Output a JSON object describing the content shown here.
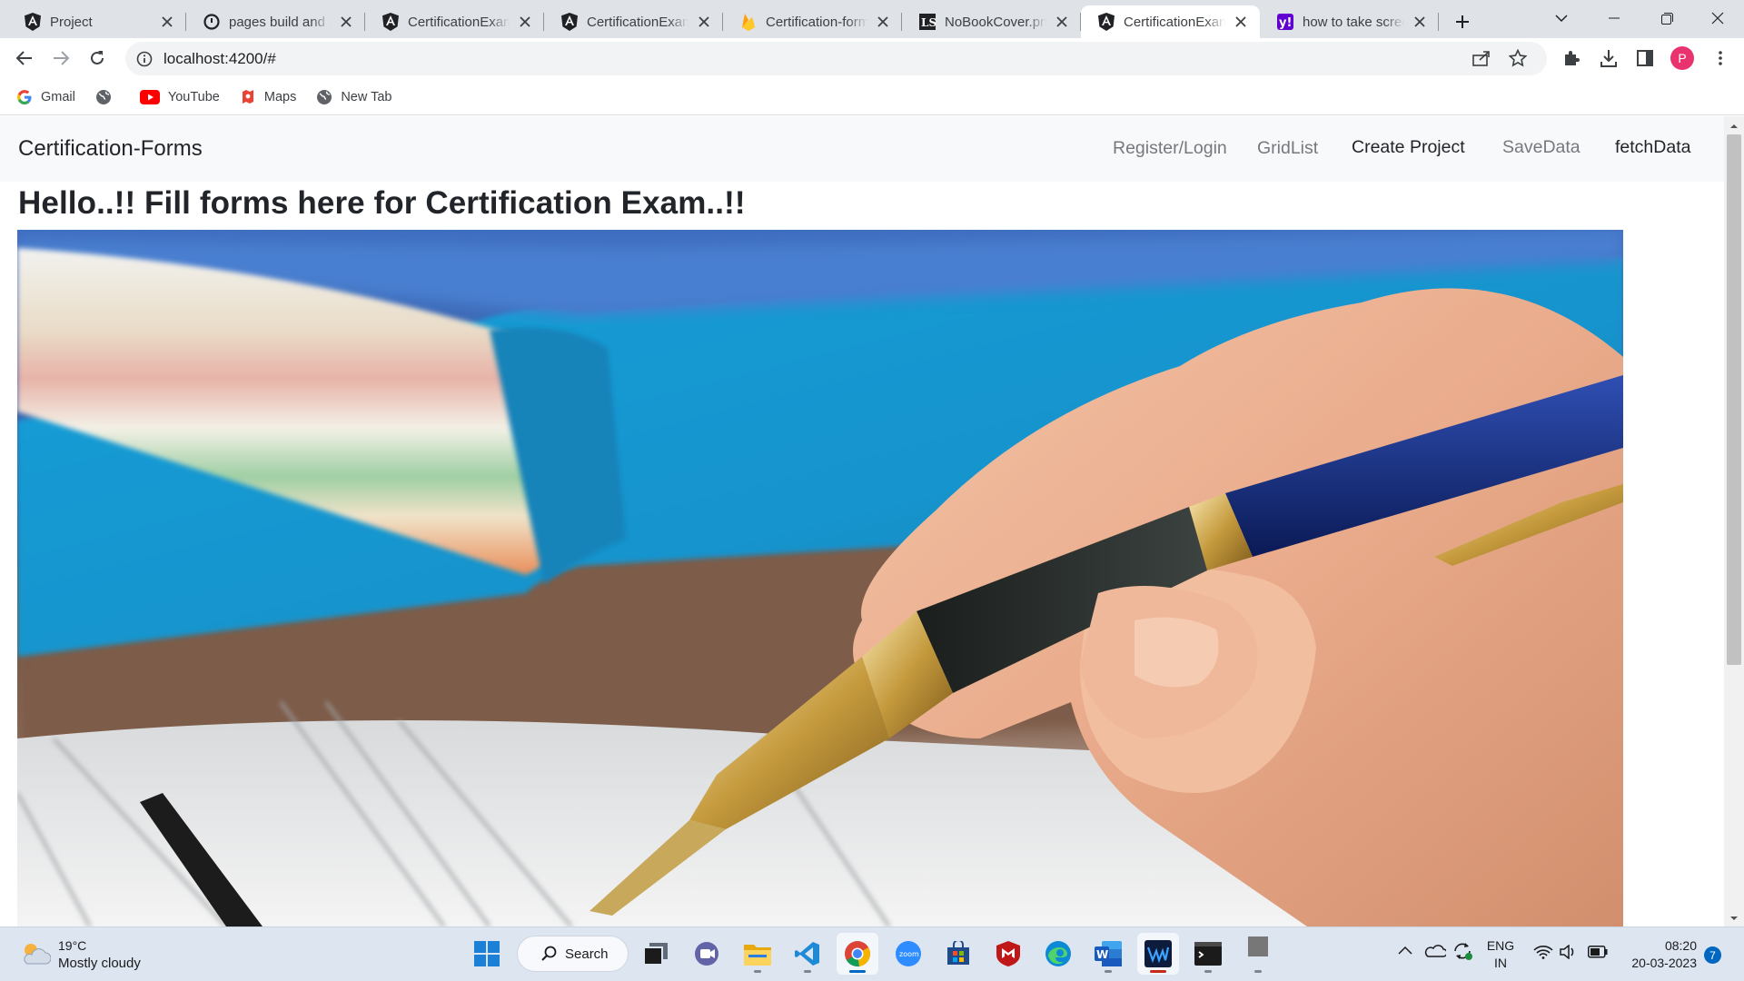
{
  "browser": {
    "tabs": [
      {
        "title": "Project",
        "icon": "angular-icon",
        "active": false
      },
      {
        "title": "pages build and deployment",
        "icon": "github-icon",
        "active": false
      },
      {
        "title": "CertificationExam",
        "icon": "angular-icon",
        "active": false
      },
      {
        "title": "CertificationExam",
        "icon": "angular-icon",
        "active": false
      },
      {
        "title": "Certification-forms",
        "icon": "firebase-icon",
        "active": false
      },
      {
        "title": "NoBookCover.png",
        "icon": "site-icon",
        "active": false
      },
      {
        "title": "CertificationExam",
        "icon": "angular-icon",
        "active": true
      },
      {
        "title": "how to take screenshot",
        "icon": "yahoo-icon",
        "active": false
      }
    ],
    "url": "localhost:4200/#",
    "profile_initial": "P",
    "bookmarks": [
      {
        "label": "Gmail",
        "icon": "google-icon"
      },
      {
        "label": "",
        "icon": "globe-icon"
      },
      {
        "label": "YouTube",
        "icon": "youtube-icon"
      },
      {
        "label": "Maps",
        "icon": "maps-icon"
      },
      {
        "label": "New Tab",
        "icon": "globe-icon"
      }
    ]
  },
  "app": {
    "brand": "Certification-Forms",
    "nav": [
      {
        "label": "Register/Login",
        "emphasis": false
      },
      {
        "label": "GridList",
        "emphasis": false
      },
      {
        "label": "Create Project",
        "emphasis": true
      },
      {
        "label": "SaveData",
        "emphasis": false
      },
      {
        "label": "fetchData",
        "emphasis": true
      }
    ],
    "heading": "Hello..!! Fill forms here for Certification Exam..!!",
    "hero_image": "photo of a hand writing with a pen on a form, blue binder in background"
  },
  "taskbar": {
    "weather": {
      "temp": "19°C",
      "condition": "Mostly cloudy"
    },
    "search_label": "Search",
    "language": {
      "primary": "ENG",
      "secondary": "IN"
    },
    "clock": {
      "time": "08:20",
      "date": "20-03-2023"
    },
    "notification_count": "7",
    "apps": [
      "start-icon",
      "taskview-icon",
      "teams-icon",
      "file-explorer-icon",
      "vscode-icon",
      "chrome-icon",
      "zoom-icon",
      "store-icon",
      "mcafee-icon",
      "edge-icon",
      "word-icon",
      "waves-icon",
      "terminal-icon",
      "app-icon"
    ]
  },
  "colors": {
    "tabstrip_bg": "#dfe3e8",
    "navbar_bg": "#f8f9fa",
    "taskbar_bg": "#dde5f1",
    "profile": "#e8336e"
  }
}
